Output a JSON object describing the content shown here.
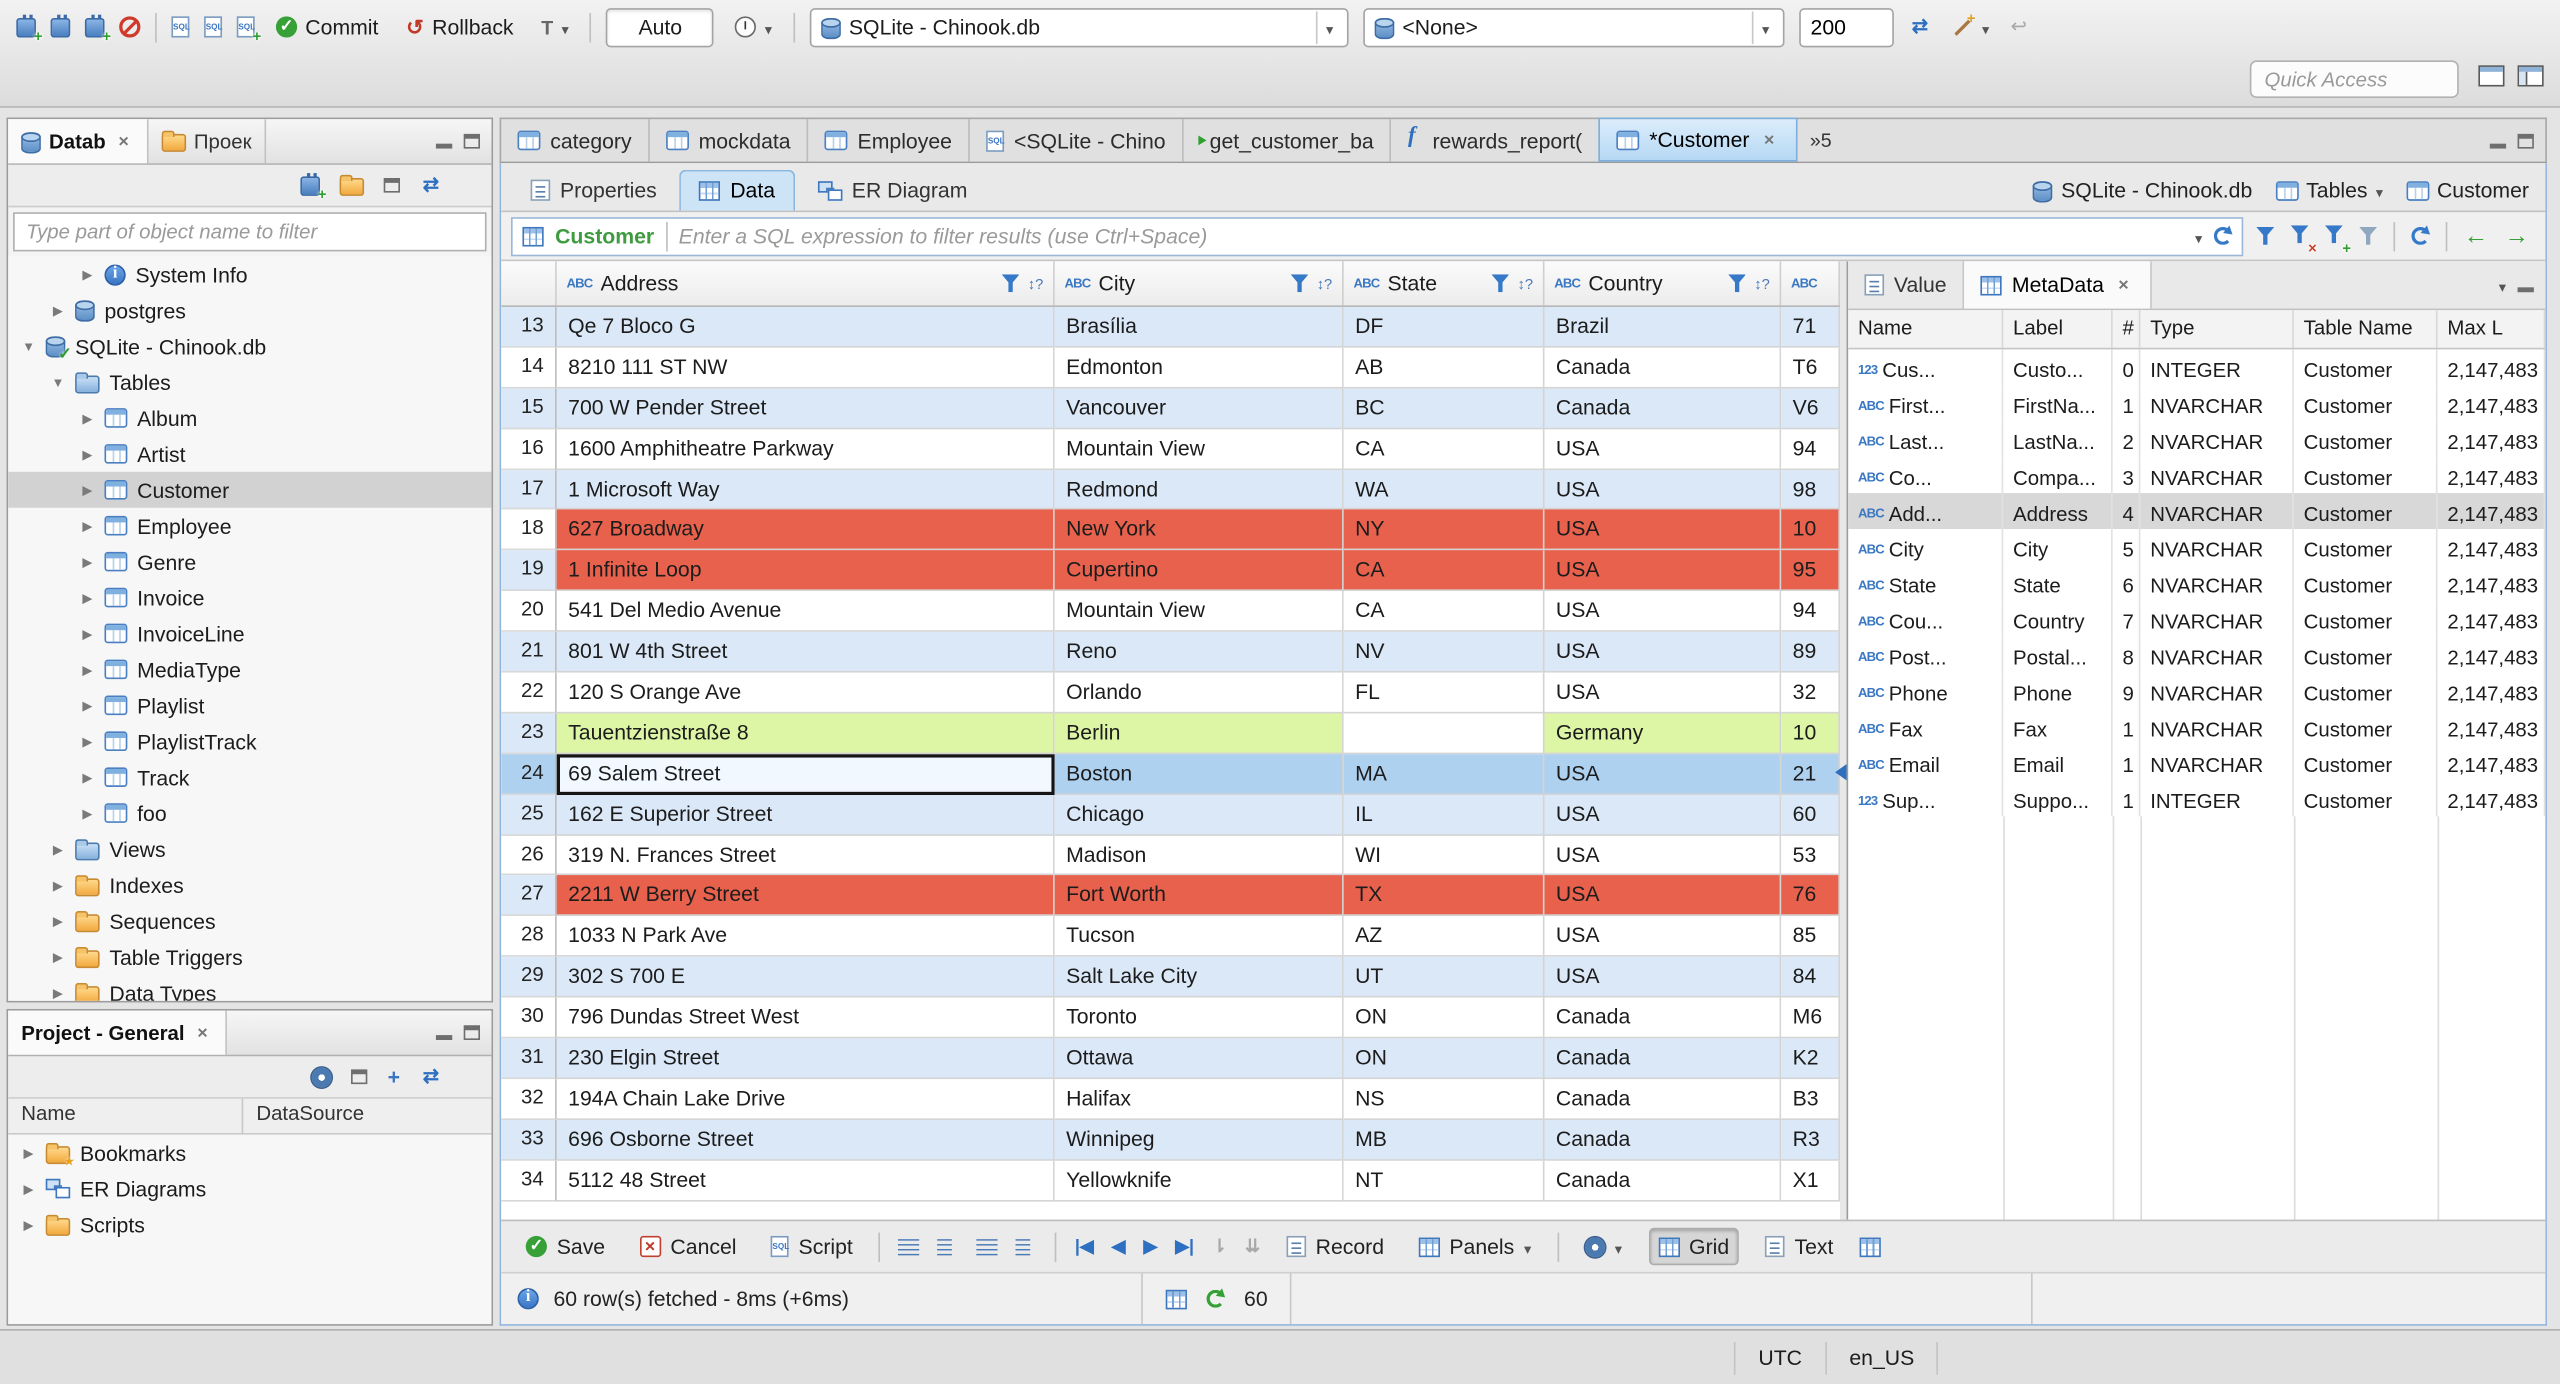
{
  "toolbar": {
    "commit_label": "Commit",
    "rollback_label": "Rollback",
    "auto_commit_label": "Auto",
    "database_combo": "SQLite - Chinook.db",
    "schema_combo": "<None>",
    "fetch_size": "200",
    "quick_access_placeholder": "Quick Access"
  },
  "navigator": {
    "tab_database": "Datab",
    "tab_projects": "Проек",
    "filter_placeholder": "Type part of object name to filter",
    "tree": [
      {
        "label": "System Info",
        "icon": "info",
        "indent": 2,
        "arrow": "collapsed"
      },
      {
        "label": "postgres",
        "icon": "db",
        "indent": 1,
        "arrow": "collapsed"
      },
      {
        "label": "SQLite - Chinook.db",
        "icon": "db-check",
        "indent": 0,
        "arrow": "expanded"
      },
      {
        "label": "Tables",
        "icon": "folder-blue",
        "indent": 1,
        "arrow": "expanded"
      },
      {
        "label": "Album",
        "icon": "table",
        "indent": 2,
        "arrow": "collapsed"
      },
      {
        "label": "Artist",
        "icon": "table",
        "indent": 2,
        "arrow": "collapsed"
      },
      {
        "label": "Customer",
        "icon": "table",
        "indent": 2,
        "arrow": "collapsed",
        "selected": true
      },
      {
        "label": "Employee",
        "icon": "table",
        "indent": 2,
        "arrow": "collapsed"
      },
      {
        "label": "Genre",
        "icon": "table",
        "indent": 2,
        "arrow": "collapsed"
      },
      {
        "label": "Invoice",
        "icon": "table",
        "indent": 2,
        "arrow": "collapsed"
      },
      {
        "label": "InvoiceLine",
        "icon": "table",
        "indent": 2,
        "arrow": "collapsed"
      },
      {
        "label": "MediaType",
        "icon": "table",
        "indent": 2,
        "arrow": "collapsed"
      },
      {
        "label": "Playlist",
        "icon": "table",
        "indent": 2,
        "arrow": "collapsed"
      },
      {
        "label": "PlaylistTrack",
        "icon": "table",
        "indent": 2,
        "arrow": "collapsed"
      },
      {
        "label": "Track",
        "icon": "table",
        "indent": 2,
        "arrow": "collapsed"
      },
      {
        "label": "foo",
        "icon": "table",
        "indent": 2,
        "arrow": "collapsed"
      },
      {
        "label": "Views",
        "icon": "folder-blue",
        "indent": 1,
        "arrow": "collapsed"
      },
      {
        "label": "Indexes",
        "icon": "folder",
        "indent": 1,
        "arrow": "collapsed"
      },
      {
        "label": "Sequences",
        "icon": "folder",
        "indent": 1,
        "arrow": "collapsed"
      },
      {
        "label": "Table Triggers",
        "icon": "folder",
        "indent": 1,
        "arrow": "collapsed"
      },
      {
        "label": "Data Types",
        "icon": "folder",
        "indent": 1,
        "arrow": "collapsed"
      }
    ]
  },
  "project": {
    "tab_label": "Project - General",
    "columns": [
      "Name",
      "DataSource"
    ],
    "items": [
      {
        "label": "Bookmarks",
        "icon": "folder-star"
      },
      {
        "label": "ER Diagrams",
        "icon": "er"
      },
      {
        "label": "Scripts",
        "icon": "folder"
      }
    ]
  },
  "editor": {
    "tabs": [
      {
        "label": "category",
        "icon": "table"
      },
      {
        "label": "mockdata",
        "icon": "table"
      },
      {
        "label": "Employee",
        "icon": "table"
      },
      {
        "label": "<SQLite - Chino",
        "icon": "sql"
      },
      {
        "label": "get_customer_ba",
        "icon": "sql-exec"
      },
      {
        "label": "rewards_report(",
        "icon": "fn"
      },
      {
        "label": "*Customer",
        "icon": "table",
        "active": true,
        "closable": true
      }
    ],
    "tab_overflow": "»5",
    "subtabs": [
      {
        "label": "Properties",
        "icon": "props"
      },
      {
        "label": "Data",
        "icon": "grid",
        "active": true
      },
      {
        "label": "ER Diagram",
        "icon": "er"
      }
    ],
    "breadcrumb": {
      "database": "SQLite - Chinook.db",
      "tables": "Tables",
      "entity": "Customer"
    }
  },
  "filter": {
    "entity": "Customer",
    "placeholder": "Enter a SQL expression to filter results (use Ctrl+Space)"
  },
  "grid": {
    "columns": [
      "Address",
      "City",
      "State",
      "Country",
      ""
    ],
    "rows": [
      {
        "num": 13,
        "cells": [
          "Qe 7 Bloco G",
          "Brasília",
          "DF",
          "Brazil",
          "71"
        ],
        "color": "alt"
      },
      {
        "num": 14,
        "cells": [
          "8210 111 ST NW",
          "Edmonton",
          "AB",
          "Canada",
          "T6"
        ],
        "color": "white"
      },
      {
        "num": 15,
        "cells": [
          "700 W Pender Street",
          "Vancouver",
          "BC",
          "Canada",
          "V6"
        ],
        "color": "alt"
      },
      {
        "num": 16,
        "cells": [
          "1600 Amphitheatre Parkway",
          "Mountain View",
          "CA",
          "USA",
          "94"
        ],
        "color": "white"
      },
      {
        "num": 17,
        "cells": [
          "1 Microsoft Way",
          "Redmond",
          "WA",
          "USA",
          "98"
        ],
        "color": "alt"
      },
      {
        "num": 18,
        "cells": [
          "627 Broadway",
          "New York",
          "NY",
          "USA",
          "10"
        ],
        "color": "red"
      },
      {
        "num": 19,
        "cells": [
          "1 Infinite Loop",
          "Cupertino",
          "CA",
          "USA",
          "95"
        ],
        "color": "red"
      },
      {
        "num": 20,
        "cells": [
          "541 Del Medio Avenue",
          "Mountain View",
          "CA",
          "USA",
          "94"
        ],
        "color": "white"
      },
      {
        "num": 21,
        "cells": [
          "801 W 4th Street",
          "Reno",
          "NV",
          "USA",
          "89"
        ],
        "color": "alt"
      },
      {
        "num": 22,
        "cells": [
          "120 S Orange Ave",
          "Orlando",
          "FL",
          "USA",
          "32"
        ],
        "color": "white"
      },
      {
        "num": 23,
        "cells": [
          "Tauentzienstraße 8",
          "Berlin",
          "",
          "Germany",
          "10"
        ],
        "color": "green"
      },
      {
        "num": 24,
        "cells": [
          "69 Salem Street",
          "Boston",
          "MA",
          "USA",
          "21"
        ],
        "color": "selected"
      },
      {
        "num": 25,
        "cells": [
          "162 E Superior Street",
          "Chicago",
          "IL",
          "USA",
          "60"
        ],
        "color": "alt"
      },
      {
        "num": 26,
        "cells": [
          "319 N. Frances Street",
          "Madison",
          "WI",
          "USA",
          "53"
        ],
        "color": "white"
      },
      {
        "num": 27,
        "cells": [
          "2211 W Berry Street",
          "Fort Worth",
          "TX",
          "USA",
          "76"
        ],
        "color": "red"
      },
      {
        "num": 28,
        "cells": [
          "1033 N Park Ave",
          "Tucson",
          "AZ",
          "USA",
          "85"
        ],
        "color": "white"
      },
      {
        "num": 29,
        "cells": [
          "302 S 700 E",
          "Salt Lake City",
          "UT",
          "USA",
          "84"
        ],
        "color": "alt"
      },
      {
        "num": 30,
        "cells": [
          "796 Dundas Street West",
          "Toronto",
          "ON",
          "Canada",
          "M6"
        ],
        "color": "white"
      },
      {
        "num": 31,
        "cells": [
          "230 Elgin Street",
          "Ottawa",
          "ON",
          "Canada",
          "K2"
        ],
        "color": "alt"
      },
      {
        "num": 32,
        "cells": [
          "194A Chain Lake Drive",
          "Halifax",
          "NS",
          "Canada",
          "B3"
        ],
        "color": "white"
      },
      {
        "num": 33,
        "cells": [
          "696 Osborne Street",
          "Winnipeg",
          "MB",
          "Canada",
          "R3"
        ],
        "color": "alt"
      },
      {
        "num": 34,
        "cells": [
          "5112 48 Street",
          "Yellowknife",
          "NT",
          "Canada",
          "X1"
        ],
        "color": "white"
      }
    ]
  },
  "metadata": {
    "tab_value": "Value",
    "tab_metadata": "MetaData",
    "columns": [
      "Name",
      "Label",
      "#",
      "Type",
      "Table Name",
      "Max L"
    ],
    "rows": [
      {
        "icon": "123",
        "name": "Cus...",
        "label": "Custo...",
        "num": "0",
        "type": "INTEGER",
        "table": "Customer",
        "max": "2,147,483"
      },
      {
        "icon": "ABC",
        "name": "First...",
        "label": "FirstNa...",
        "num": "1",
        "type": "NVARCHAR",
        "table": "Customer",
        "max": "2,147,483"
      },
      {
        "icon": "ABC",
        "name": "Last...",
        "label": "LastNa...",
        "num": "2",
        "type": "NVARCHAR",
        "table": "Customer",
        "max": "2,147,483"
      },
      {
        "icon": "ABC",
        "name": "Co...",
        "label": "Compa...",
        "num": "3",
        "type": "NVARCHAR",
        "table": "Customer",
        "max": "2,147,483"
      },
      {
        "icon": "ABC",
        "name": "Add...",
        "label": "Address",
        "num": "4",
        "type": "NVARCHAR",
        "table": "Customer",
        "max": "2,147,483",
        "selected": true
      },
      {
        "icon": "ABC",
        "name": "City",
        "label": "City",
        "num": "5",
        "type": "NVARCHAR",
        "table": "Customer",
        "max": "2,147,483"
      },
      {
        "icon": "ABC",
        "name": "State",
        "label": "State",
        "num": "6",
        "type": "NVARCHAR",
        "table": "Customer",
        "max": "2,147,483"
      },
      {
        "icon": "ABC",
        "name": "Cou...",
        "label": "Country",
        "num": "7",
        "type": "NVARCHAR",
        "table": "Customer",
        "max": "2,147,483"
      },
      {
        "icon": "ABC",
        "name": "Post...",
        "label": "Postal...",
        "num": "8",
        "type": "NVARCHAR",
        "table": "Customer",
        "max": "2,147,483"
      },
      {
        "icon": "ABC",
        "name": "Phone",
        "label": "Phone",
        "num": "9",
        "type": "NVARCHAR",
        "table": "Customer",
        "max": "2,147,483"
      },
      {
        "icon": "ABC",
        "name": "Fax",
        "label": "Fax",
        "num": "1",
        "type": "NVARCHAR",
        "table": "Customer",
        "max": "2,147,483"
      },
      {
        "icon": "ABC",
        "name": "Email",
        "label": "Email",
        "num": "1",
        "type": "NVARCHAR",
        "table": "Customer",
        "max": "2,147,483"
      },
      {
        "icon": "123",
        "name": "Sup...",
        "label": "Suppo...",
        "num": "1",
        "type": "INTEGER",
        "table": "Customer",
        "max": "2,147,483"
      }
    ]
  },
  "result_toolbar": {
    "save": "Save",
    "cancel": "Cancel",
    "script": "Script",
    "record": "Record",
    "panels": "Panels",
    "grid": "Grid",
    "text": "Text"
  },
  "result_status": {
    "message": "60 row(s) fetched - 8ms (+6ms)",
    "row_count": "60"
  },
  "statusbar": {
    "timezone": "UTC",
    "locale": "en_US"
  }
}
